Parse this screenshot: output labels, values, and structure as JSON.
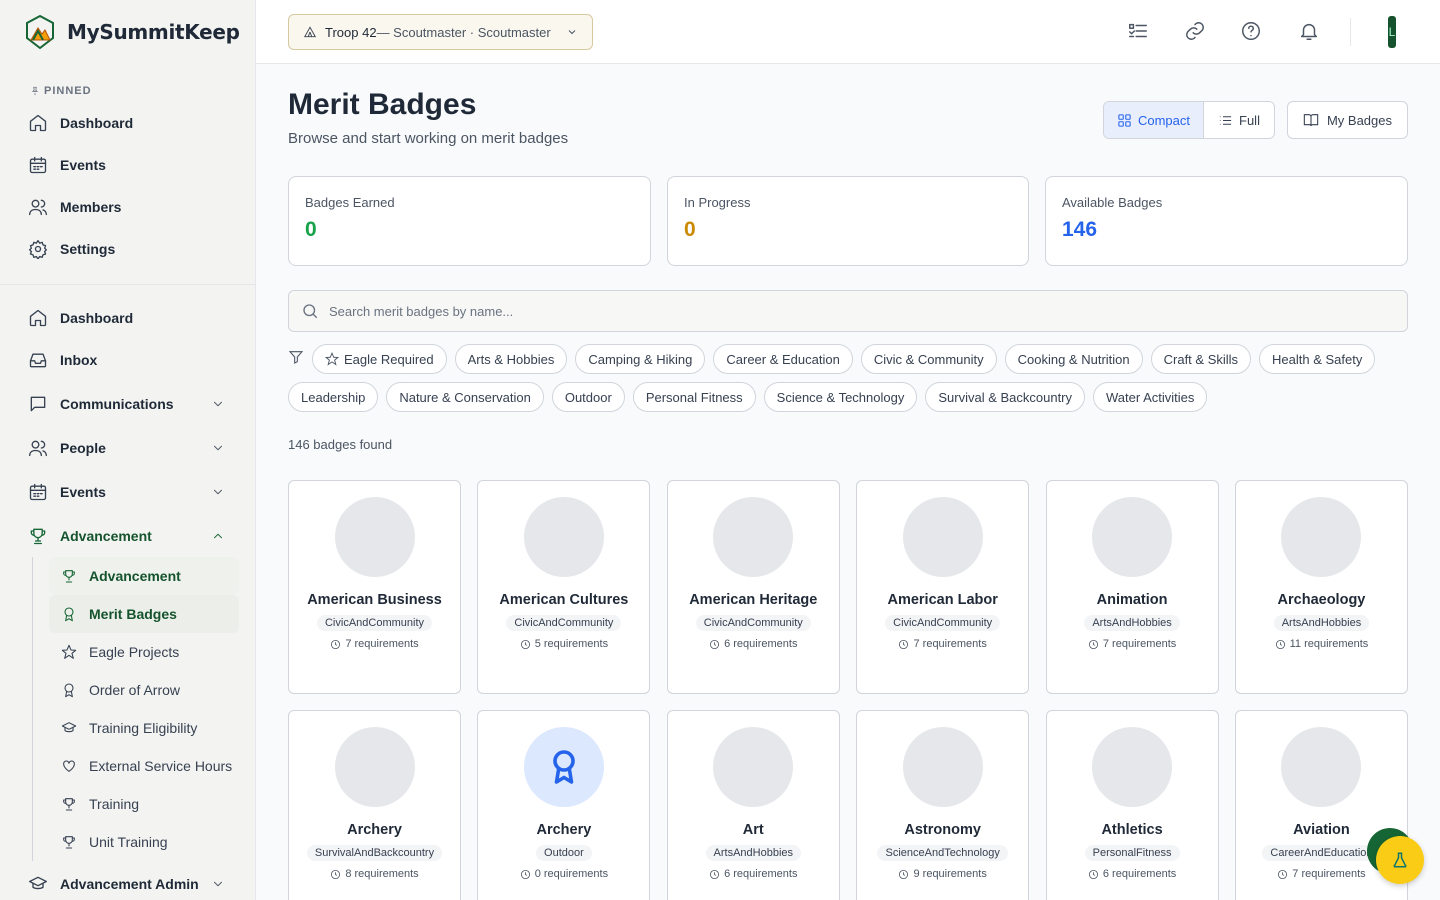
{
  "app": {
    "name": "MySummitKeep"
  },
  "sidebar": {
    "pinned_label": "PINNED",
    "pinned": [
      {
        "label": "Dashboard"
      },
      {
        "label": "Events"
      },
      {
        "label": "Members"
      },
      {
        "label": "Settings"
      }
    ],
    "main": [
      {
        "label": "Dashboard"
      },
      {
        "label": "Inbox"
      },
      {
        "label": "Communications"
      },
      {
        "label": "People"
      },
      {
        "label": "Events"
      },
      {
        "label": "Advancement"
      }
    ],
    "advancement_sub": [
      {
        "label": "Advancement"
      },
      {
        "label": "Merit Badges"
      },
      {
        "label": "Eagle Projects"
      },
      {
        "label": "Order of Arrow"
      },
      {
        "label": "Training Eligibility"
      },
      {
        "label": "External Service Hours"
      },
      {
        "label": "Training"
      },
      {
        "label": "Unit Training"
      }
    ],
    "admin": {
      "label": "Advancement Admin"
    }
  },
  "topbar": {
    "troop_name": "Troop 42",
    "troop_role": " — Scoutmaster · Scoutmaster",
    "avatar_initial": "L"
  },
  "page": {
    "title": "Merit Badges",
    "subtitle": "Browse and start working on merit badges",
    "view_compact": "Compact",
    "view_full": "Full",
    "my_badges": "My Badges"
  },
  "stats": {
    "earned_label": "Badges Earned",
    "earned_value": "0",
    "earned_color": "#16a34a",
    "progress_label": "In Progress",
    "progress_value": "0",
    "progress_color": "#ca8a04",
    "available_label": "Available Badges",
    "available_value": "146",
    "available_color": "#2563eb"
  },
  "search": {
    "placeholder": "Search merit badges by name..."
  },
  "filters": {
    "row1": [
      "Eagle Required",
      "Arts & Hobbies",
      "Camping & Hiking",
      "Career & Education",
      "Civic & Community",
      "Cooking & Nutrition",
      "Craft & Skills",
      "Health & Safety"
    ],
    "row2": [
      "Leadership",
      "Nature & Conservation",
      "Outdoor",
      "Personal Fitness",
      "Science & Technology",
      "Survival & Backcountry",
      "Water Activities"
    ]
  },
  "results": {
    "count_text": "146 badges found"
  },
  "badges": [
    {
      "name": "American Business",
      "category": "CivicAndCommunity",
      "requirements": "7 requirements"
    },
    {
      "name": "American Cultures",
      "category": "CivicAndCommunity",
      "requirements": "5 requirements"
    },
    {
      "name": "American Heritage",
      "category": "CivicAndCommunity",
      "requirements": "6 requirements"
    },
    {
      "name": "American Labor",
      "category": "CivicAndCommunity",
      "requirements": "7 requirements"
    },
    {
      "name": "Animation",
      "category": "ArtsAndHobbies",
      "requirements": "7 requirements"
    },
    {
      "name": "Archaeology",
      "category": "ArtsAndHobbies",
      "requirements": "11 requirements"
    },
    {
      "name": "Archery",
      "category": "SurvivalAndBackcountry",
      "requirements": "8 requirements"
    },
    {
      "name": "Archery",
      "category": "Outdoor",
      "requirements": "0 requirements",
      "icon": "award-icon"
    },
    {
      "name": "Art",
      "category": "ArtsAndHobbies",
      "requirements": "6 requirements"
    },
    {
      "name": "Astronomy",
      "category": "ScienceAndTechnology",
      "requirements": "9 requirements"
    },
    {
      "name": "Athletics",
      "category": "PersonalFitness",
      "requirements": "6 requirements"
    },
    {
      "name": "Aviation",
      "category": "CareerAndEducation",
      "requirements": "7 requirements"
    }
  ]
}
